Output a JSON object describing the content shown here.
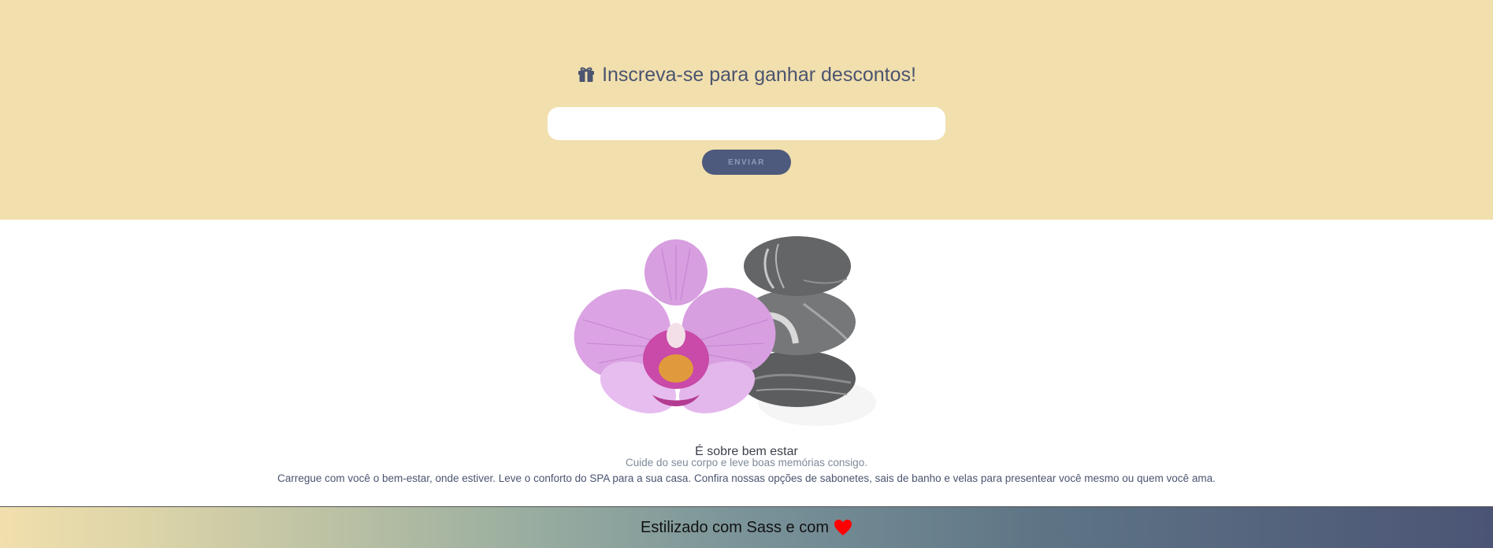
{
  "signup": {
    "title": "Inscreva-se para ganhar descontos!",
    "email_value": "",
    "email_placeholder": "",
    "send_label": "ENVIAR",
    "background_color": "#f1dfad",
    "gift_icon": "gift-icon"
  },
  "about": {
    "image_icon": "orchid-and-stones-image",
    "title": "É sobre bem estar",
    "subtitle": "Cuide do seu corpo e leve boas memórias consigo.",
    "text": "Carregue com você o bem-estar, onde estiver. Leve o conforto do SPA para a sua casa. Confira nossas opções de sabonetes, sais de banho e velas para presentear você mesmo ou quem você ama."
  },
  "footer": {
    "text": "Estilizado com Sass e com",
    "heart_icon": "heart-icon",
    "heart_color": "#ff0000"
  }
}
